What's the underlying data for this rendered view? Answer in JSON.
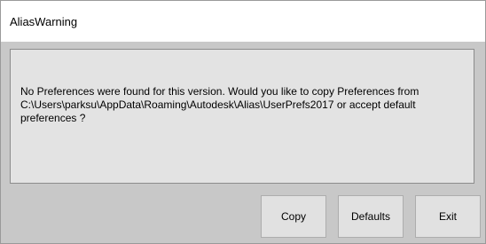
{
  "window": {
    "title": "AliasWarning"
  },
  "message": {
    "text": "No Preferences were found for this version. Would you like to copy Preferences from C:\\Users\\parksu\\AppData\\Roaming\\Autodesk\\Alias\\UserPrefs2017 or accept default preferences ?"
  },
  "buttons": {
    "copy_label": "Copy",
    "defaults_label": "Defaults",
    "exit_label": "Exit"
  },
  "colors": {
    "window_background": "#c8c8c8",
    "titlebar_background": "#ffffff",
    "panel_background": "#e3e3e3",
    "button_background": "#e1e1e1"
  }
}
